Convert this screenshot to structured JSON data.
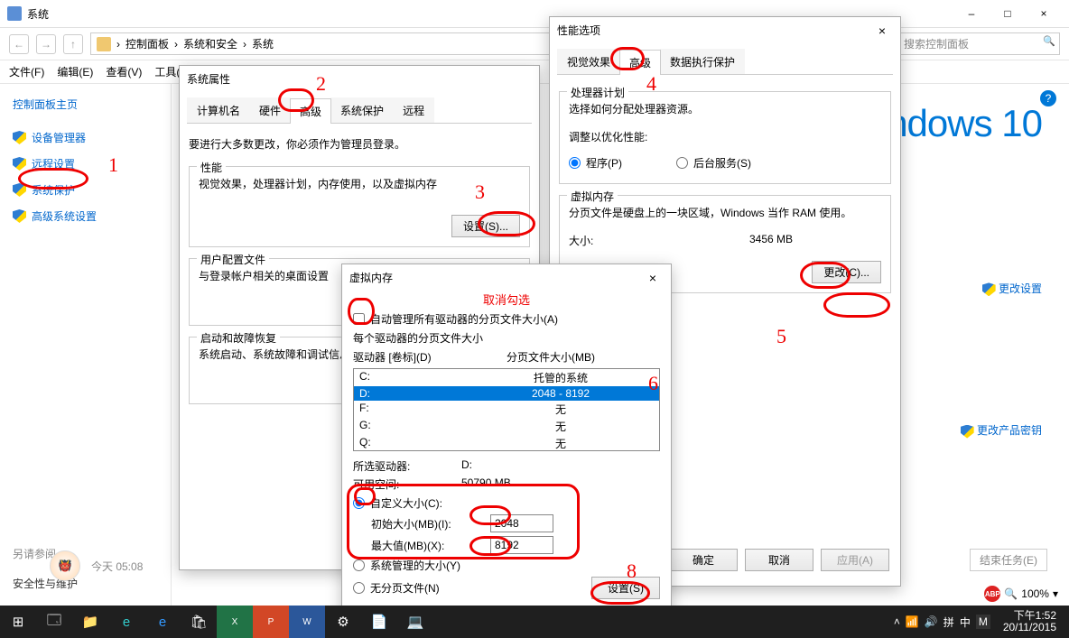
{
  "main_win": {
    "title": "系统",
    "sysctl_min": "–",
    "sysctl_max": "□",
    "sysctl_close": "×"
  },
  "nav": {
    "ctl": "控制面板",
    "sec": "系统和安全",
    "sys": "系统"
  },
  "menubar": {
    "file": "文件(F)",
    "edit": "编辑(E)",
    "view": "查看(V)",
    "tools": "工具(T)"
  },
  "search": {
    "placeholder": "搜索控制面板"
  },
  "sidebar": {
    "title": "控制面板主页",
    "items": [
      "设备管理器",
      "远程设置",
      "系统保护",
      "高级系统设置"
    ],
    "see_also": "另请参阅",
    "sec_maint": "安全性与维护"
  },
  "right": {
    "brand": "ndows 10",
    "change_settings": "更改设置",
    "change_key": "更改产品密钥"
  },
  "help": "?",
  "sysprops": {
    "title": "系统属性",
    "tabs": {
      "computer": "计算机名",
      "hardware": "硬件",
      "advanced": "高级",
      "protection": "系统保护",
      "remote": "远程"
    },
    "admin_note": "要进行大多数更改，你必须作为管理员登录。",
    "perf": {
      "legend": "性能",
      "desc": "视觉效果，处理器计划，内存使用，以及虚拟内存",
      "btn": "设置(S)..."
    },
    "profile": {
      "legend": "用户配置文件",
      "desc": "与登录帐户相关的桌面设置"
    },
    "startup": {
      "legend": "启动和故障恢复",
      "desc": "系统启动、系统故障和调试信息"
    }
  },
  "perfopt": {
    "title": "性能选项",
    "close": "×",
    "tabs": {
      "visual": "视觉效果",
      "advanced": "高级",
      "dep": "数据执行保护"
    },
    "sched": {
      "legend": "处理器计划",
      "desc": "选择如何分配处理器资源。",
      "adjust": "调整以优化性能:",
      "prog": "程序(P)",
      "svc": "后台服务(S)"
    },
    "vm": {
      "legend": "虚拟内存",
      "desc": "分页文件是硬盘上的一块区域，Windows 当作 RAM 使用。",
      "size_lbl": "大小:",
      "size_val": "3456 MB",
      "btn": "更改(C)..."
    },
    "btns": {
      "ok": "确定",
      "cancel": "取消",
      "apply": "应用(A)"
    }
  },
  "vmem": {
    "title": "虚拟内存",
    "close": "×",
    "cancel_note": "取消勾选",
    "auto": "自动管理所有驱动器的分页文件大小(A)",
    "each": "每个驱动器的分页文件大小",
    "drv_lbl": "驱动器 [卷标](D)",
    "size_lbl": "分页文件大小(MB)",
    "drives": [
      {
        "d": "C:",
        "s": "托管的系统"
      },
      {
        "d": "D:",
        "s": "2048 - 8192"
      },
      {
        "d": "F:",
        "s": "无"
      },
      {
        "d": "G:",
        "s": "无"
      },
      {
        "d": "Q:",
        "s": "无"
      }
    ],
    "sel_lbl": "所选驱动器:",
    "sel_val": "D:",
    "avail_lbl": "可用空间:",
    "avail_val": "50790 MB",
    "custom": "自定义大小(C):",
    "init_lbl": "初始大小(MB)(I):",
    "init_val": "2048",
    "max_lbl": "最大值(MB)(X):",
    "max_val": "8192",
    "sysman": "系统管理的大小(Y)",
    "none": "无分页文件(N)",
    "setbtn": "设置(S)"
  },
  "avatar": {
    "time": "今天 05:08",
    "emoji": "👹"
  },
  "endtask": "结束任务(E)",
  "zoom": {
    "val": "100%"
  },
  "tray": {
    "time": "下午1:52",
    "date": "20/11/2015"
  }
}
